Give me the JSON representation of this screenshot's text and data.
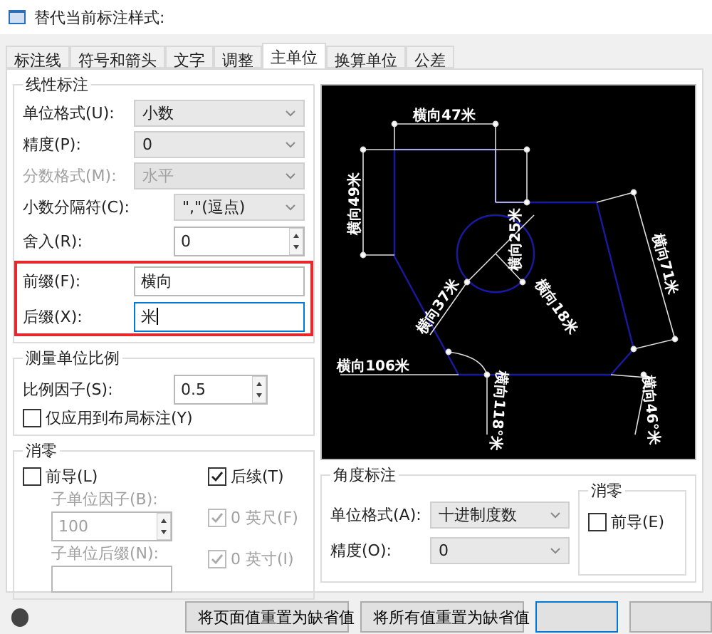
{
  "window": {
    "title": "替代当前标注样式:"
  },
  "tabs": [
    {
      "label": "标注线",
      "selected": false
    },
    {
      "label": "符号和箭头",
      "selected": false
    },
    {
      "label": "文字",
      "selected": false
    },
    {
      "label": "调整",
      "selected": false
    },
    {
      "label": "主单位",
      "selected": true
    },
    {
      "label": "换算单位",
      "selected": false
    },
    {
      "label": "公差",
      "selected": false
    }
  ],
  "linear": {
    "title": "线性标注",
    "fields": [
      {
        "kind": "select",
        "label": "单位格式(U):",
        "value": "小数",
        "disabled": false,
        "narrow": false
      },
      {
        "kind": "select",
        "label": "精度(P):",
        "value": "0",
        "disabled": false,
        "narrow": false
      },
      {
        "kind": "select",
        "label": "分数格式(M):",
        "value": "水平",
        "disabled": true,
        "narrow": false
      },
      {
        "kind": "select",
        "label": "小数分隔符(C):",
        "value": "\",\"(逗点)",
        "disabled": false,
        "narrow": true
      },
      {
        "kind": "spin",
        "label": "舍入(R):",
        "value": "0",
        "disabled": false,
        "narrow": true
      },
      {
        "kind": "text",
        "label": "前缀(F):",
        "value": "横向",
        "focused": false,
        "highlighted": true
      },
      {
        "kind": "text",
        "label": "后缀(X):",
        "value": "米",
        "focused": true,
        "highlighted": true
      }
    ]
  },
  "scale": {
    "title": "测量单位比例",
    "factor_label": "比例因子(S):",
    "factor": "0.5",
    "layout_only": {
      "label": "仅应用到布局标注(Y)",
      "checked": false
    }
  },
  "zero": {
    "title": "消零",
    "leading": {
      "label": "前导(L)",
      "checked": false
    },
    "trailing": {
      "label": "后续(T)",
      "checked": true
    },
    "sub_factor_label": "子单位因子(B):",
    "sub_factor": "100",
    "sub_suffix_label": "子单位后缀(N):",
    "feet": {
      "label": "0 英尺(F)",
      "checked": true,
      "disabled": true
    },
    "inches": {
      "label": "0 英寸(I)",
      "checked": true,
      "disabled": true
    }
  },
  "preview": {
    "labels": [
      "横向47米",
      "横向49米",
      "横向25米",
      "横向71米",
      "横向37米",
      "横向18米",
      "横向106米",
      "横向118°米",
      "横向46°米"
    ]
  },
  "angular": {
    "title": "角度标注",
    "format_label": "单位格式(A):",
    "format": "十进制度数",
    "precision_label": "精度(O):",
    "precision": "0",
    "zero": {
      "title": "消零",
      "leading": {
        "label": "前导(E)",
        "checked": false
      }
    }
  },
  "buttons": [
    {
      "label": "将页面值重置为缺省值",
      "primary": false
    },
    {
      "label": "将所有值重置为缺省值",
      "primary": false
    },
    {
      "primary": true
    },
    {
      "primary": false
    }
  ]
}
